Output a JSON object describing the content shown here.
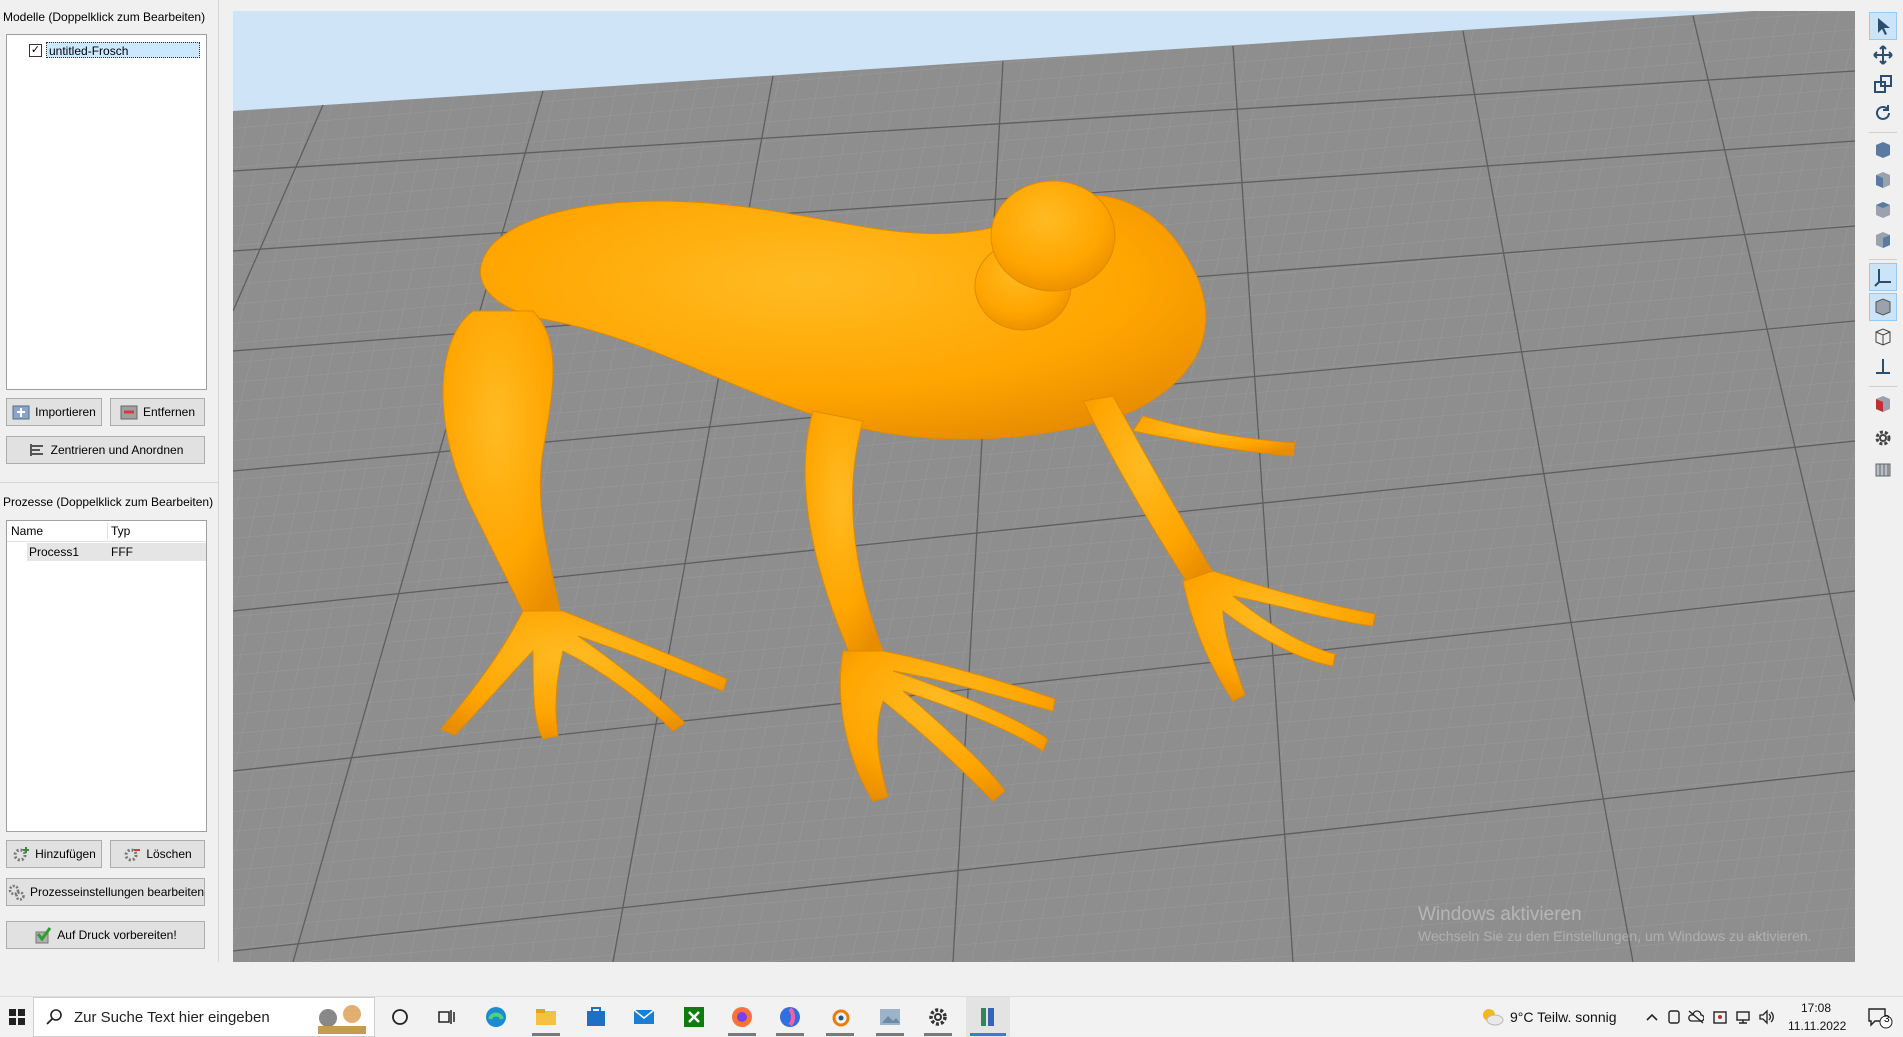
{
  "models_panel": {
    "title": "Modelle (Doppelklick zum Bearbeiten)",
    "items": [
      {
        "name": "untitled-Frosch",
        "checked": true
      }
    ],
    "import_button": "Importieren",
    "remove_button": "Entfernen",
    "center_button": "Zentrieren und Anordnen"
  },
  "process_panel": {
    "title": "Prozesse (Doppelklick zum Bearbeiten)",
    "columns": [
      "Name",
      "Typ"
    ],
    "rows": [
      {
        "name": "Process1",
        "type": "FFF"
      }
    ],
    "add_button": "Hinzufügen",
    "delete_button": "Löschen",
    "settings_button": "Prozesseinstellungen bearbeiten",
    "prepare_button": "Auf Druck vorbereiten!"
  },
  "viewport": {
    "model_color": "#ffa500",
    "bed_color": "#8c8c8c",
    "sky_color": "#cfe4f6",
    "watermark_title": "Windows aktivieren",
    "watermark_text": "Wechseln Sie zu den Einstellungen, um Windows zu aktivieren."
  },
  "toolbar": {
    "tools": [
      "select-icon",
      "move-icon",
      "scale-icon",
      "rotate-icon",
      "view-front-icon",
      "view-side-icon",
      "view-top-icon",
      "view-iso-icon",
      "axes-icon",
      "solid-view-icon",
      "wireframe-icon",
      "bed-axis-icon",
      "section-icon",
      "settings-icon",
      "layers-icon"
    ],
    "active": "axes-icon"
  },
  "taskbar": {
    "search_placeholder": "Zur Suche Text hier eingeben",
    "weather": "9°C  Teilw. sonnig",
    "time": "17:08",
    "date": "11.11.2022",
    "notification_count": "3",
    "apps": [
      "cortana-icon",
      "task-view-icon",
      "edge-icon",
      "explorer-icon",
      "store-icon",
      "mail-icon",
      "xbox-icon",
      "firefox-icon",
      "firefox-dev-icon",
      "blender-icon",
      "photos-icon",
      "settings-icon",
      "slicer-app-icon"
    ]
  }
}
